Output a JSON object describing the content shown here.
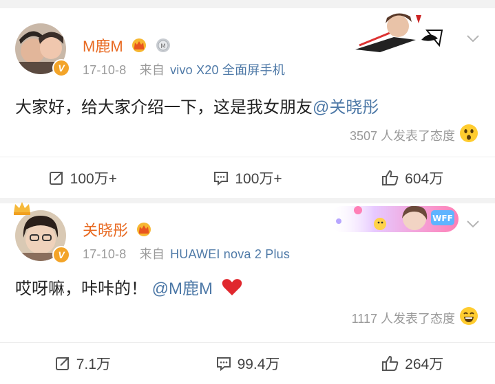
{
  "post1": {
    "author": "M鹿M",
    "date": "17-10-8",
    "from_label": "来自",
    "source": "vivo X20 全面屏手机",
    "text_plain": "大家好，给大家介绍一下，这是我女朋友",
    "mention": "@关晓彤",
    "reaction_text": "3507 人发表了态度",
    "actions": {
      "repost": "100万+",
      "comment": "100万+",
      "like": "604万"
    },
    "banner_icon": "game-promo-figure-icon"
  },
  "post2": {
    "author": "关晓彤",
    "date": "17-10-8",
    "from_label": "来自",
    "source": "HUAWEI nova 2 Plus",
    "text_plain": "哎呀嘛，咔咔的！",
    "mention": "@M鹿M",
    "reaction_text": "1117 人发表了态度",
    "actions": {
      "repost": "7.1万",
      "comment": "99.4万",
      "like": "264万"
    },
    "banner_icon": "wff-promo-badge-icon"
  },
  "colors": {
    "name": "#e86a22",
    "link": "#4e79a7",
    "meta": "#999999",
    "verified": "#f3a428"
  }
}
